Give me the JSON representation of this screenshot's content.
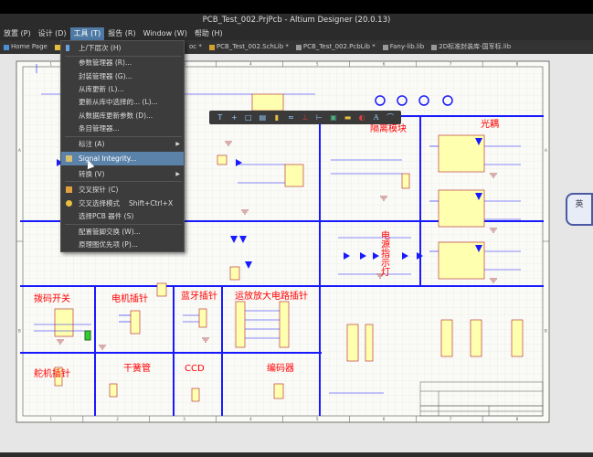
{
  "window": {
    "title": "PCB_Test_002.PrjPcb - Altium Designer (20.0.13)"
  },
  "menubar": [
    {
      "label": "放置 (P)"
    },
    {
      "label": "设计 (D)"
    },
    {
      "label": "工具 (T)"
    },
    {
      "label": "报告 (R)"
    },
    {
      "label": "Window (W)"
    },
    {
      "label": "帮助 (H)"
    }
  ],
  "tabs": [
    {
      "label": "Home Page"
    },
    {
      "label": "P"
    },
    {
      "label": "oc *"
    },
    {
      "label": "PCB_Test_002.SchLib *"
    },
    {
      "label": "PCB_Test_002.PcbLib *"
    },
    {
      "label": "Fany-lib.lib"
    },
    {
      "label": "2D标准封装库-国军标.lib"
    }
  ],
  "tools_menu": {
    "items": [
      {
        "label": "上/下层次 (H)"
      },
      {
        "label": "参数管理器 (R)..."
      },
      {
        "label": "封装管理器 (G)..."
      },
      {
        "label": "从库更新 (L)..."
      },
      {
        "label": "更新从库中选择的... (L)..."
      },
      {
        "label": "从数据库更新参数 (D)..."
      },
      {
        "label": "条目管理器..."
      },
      {
        "label": "标注 (A)",
        "submenu": true
      },
      {
        "label": "Signal Integrity...",
        "highlighted": true
      },
      {
        "label": "转换 (V)",
        "submenu": true
      },
      {
        "label": "交叉探针 (C)"
      },
      {
        "label": "交叉选择模式",
        "shortcut": "Shift+Ctrl+X"
      },
      {
        "label": "选择PCB 器件 (S)"
      },
      {
        "label": "配置管脚交换 (W)..."
      },
      {
        "label": "原理图优先项 (P)..."
      }
    ]
  },
  "schematic": {
    "sections": [
      {
        "label": "隔离模块"
      },
      {
        "label": "光耦"
      },
      {
        "label": "电源指示灯"
      },
      {
        "label": "拨码开关"
      },
      {
        "label": "电机插针"
      },
      {
        "label": "蓝牙插针"
      },
      {
        "label": "运放放大电路插针"
      },
      {
        "label": "舵机插针"
      },
      {
        "label": "干簧管"
      },
      {
        "label": "CCD"
      },
      {
        "label": "编码器"
      }
    ],
    "colors": {
      "wire": "#1a1aff",
      "section_label": "#ff0000",
      "component_fill": "#ffffb0",
      "component_border": "#b22222",
      "grid": "#e0dcd8",
      "sheet": "#fafaf7"
    },
    "border_columns": [
      "1",
      "2",
      "3",
      "4",
      "5",
      "6",
      "7",
      "8"
    ],
    "border_rows": [
      "A",
      "B"
    ]
  },
  "overlay": {
    "ime_label": "英"
  }
}
